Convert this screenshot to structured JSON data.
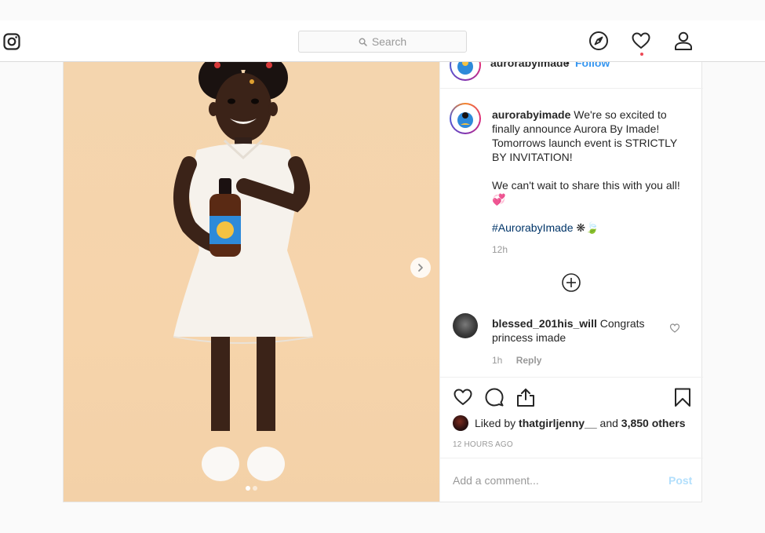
{
  "topbar": {
    "search_placeholder": "Search",
    "icons": [
      "instagram-logo-icon",
      "search-icon",
      "compass-icon",
      "heart-icon",
      "profile-icon"
    ],
    "notification_dot_color": "#ed4956"
  },
  "post": {
    "header": {
      "username": "aurorabyimade",
      "separator": "•",
      "follow": "Follow"
    },
    "caption": {
      "username": "aurorabyimade",
      "line1": "We're so excited to finally announce Aurora By Imade! Tomorrows launch event is STRICTLY BY INVITATION!",
      "line2": "We can't wait to share this with you all! 💞",
      "hashtag": "#AurorabyImade",
      "emoji": "❋🍃",
      "time": "12h"
    },
    "comment": {
      "username": "blessed_201his_will",
      "text": "Congrats princess imade",
      "time": "1h",
      "reply": "Reply"
    },
    "likes": {
      "prefix": "Liked by",
      "user": "thatgirljenny__",
      "middle": "and",
      "others": "3,850 others"
    },
    "time_ago": "12 HOURS AGO",
    "add_comment_placeholder": "Add a comment...",
    "post_button": "Post",
    "carousel": {
      "current": 1,
      "total": 2
    },
    "colors": {
      "link": "#3897f0",
      "hashtag": "#003569",
      "muted": "#999999"
    }
  }
}
